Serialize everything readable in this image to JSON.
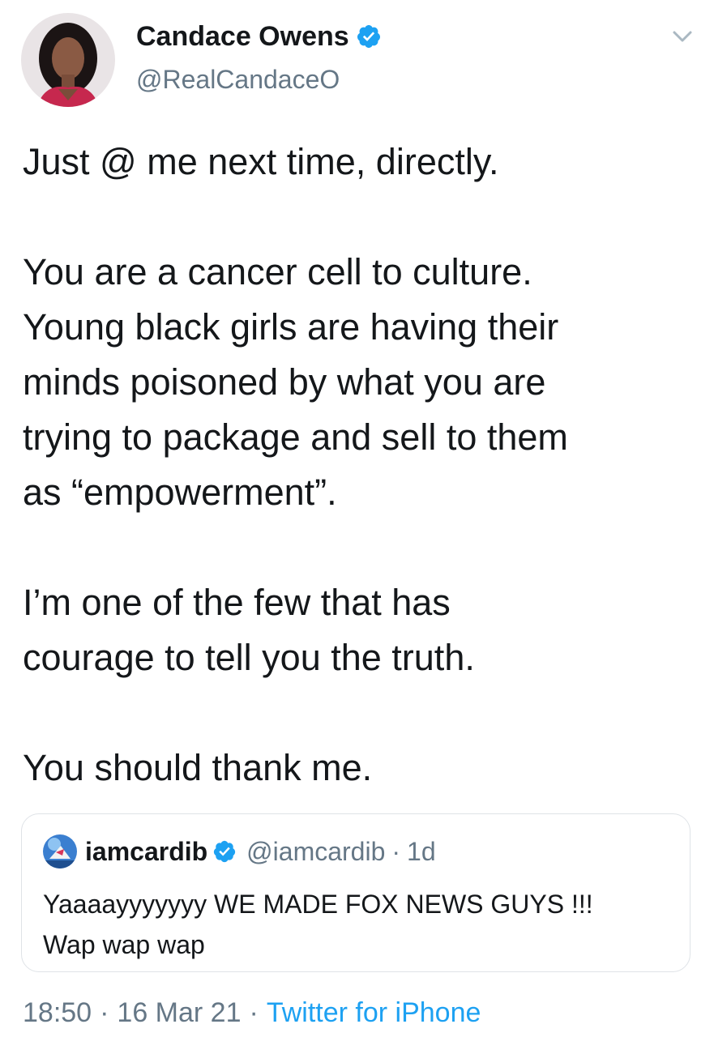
{
  "author": {
    "display_name": "Candace Owens",
    "handle": "@RealCandaceO",
    "verified": true,
    "avatar_icon": "profile-photo"
  },
  "tweet": {
    "text": "Just @ me next time, directly.\n\nYou are a cancer cell to culture.\nYoung black girls are having their\nminds poisoned by what you are\ntrying to package and sell to them\nas “empowerment”.\n\nI’m one of the few that has\ncourage to tell you the truth.\n\nYou should thank me."
  },
  "quoted_tweet": {
    "display_name": "iamcardib",
    "handle": "@iamcardib",
    "separator": "·",
    "time": "1d",
    "verified": true,
    "text": "Yaaaayyyyyyy WE MADE FOX NEWS GUYS !!!\nWap wap wap"
  },
  "meta": {
    "time": "18:50",
    "separator": "·",
    "date": "16 Mar 21",
    "separator2": "·",
    "source": "Twitter for iPhone"
  },
  "colors": {
    "text": "#14171a",
    "secondary": "#657786",
    "accent": "#1da1f2",
    "border": "#dfe3e7"
  }
}
